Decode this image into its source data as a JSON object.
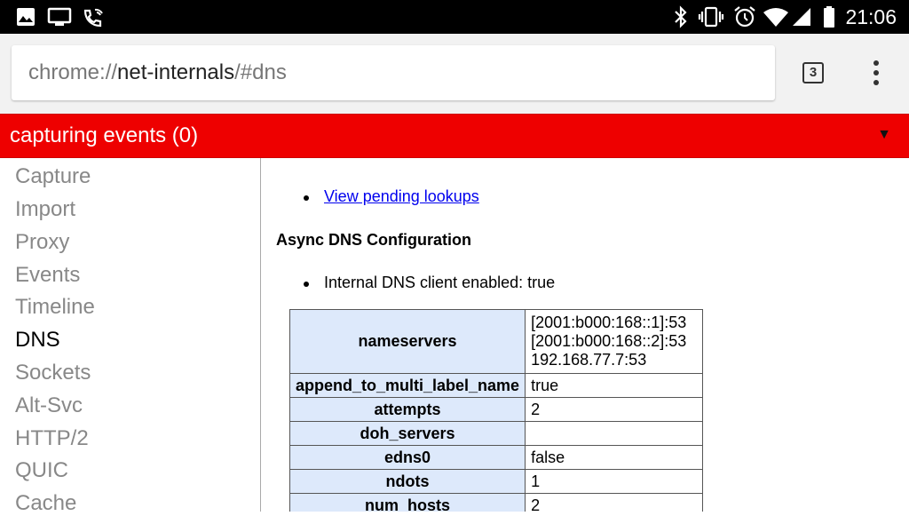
{
  "status_bar": {
    "left_icons": [
      "image-icon",
      "cast-icon",
      "wifi-call-icon"
    ],
    "right_icons": [
      "bluetooth-icon",
      "vibrate-icon",
      "alarm-icon",
      "wifi-icon",
      "signal-icon",
      "battery-icon"
    ],
    "time": "21:06"
  },
  "toolbar": {
    "url_scheme": "chrome://",
    "url_host": "net-internals",
    "url_path": "/#dns",
    "tab_count": "3"
  },
  "banner": {
    "text": "capturing events (0)",
    "arrow": "▼",
    "color": "#ee0000"
  },
  "sidebar": {
    "items": [
      {
        "label": "Capture"
      },
      {
        "label": "Import"
      },
      {
        "label": "Proxy"
      },
      {
        "label": "Events"
      },
      {
        "label": "Timeline"
      },
      {
        "label": "DNS"
      },
      {
        "label": "Sockets"
      },
      {
        "label": "Alt-Svc"
      },
      {
        "label": "HTTP/2"
      },
      {
        "label": "QUIC"
      },
      {
        "label": "Cache"
      }
    ],
    "active": "DNS"
  },
  "main": {
    "pending_link": "View pending lookups",
    "section_title": "Async DNS Configuration",
    "internal_client": "Internal DNS client enabled: true",
    "config": [
      {
        "key": "nameservers",
        "value": [
          "[2001:b000:168::1]:53",
          "[2001:b000:168::2]:53",
          "192.168.77.7:53"
        ]
      },
      {
        "key": "append_to_multi_label_name",
        "value": "true"
      },
      {
        "key": "attempts",
        "value": "2"
      },
      {
        "key": "doh_servers",
        "value": ""
      },
      {
        "key": "edns0",
        "value": "false"
      },
      {
        "key": "ndots",
        "value": "1"
      },
      {
        "key": "num_hosts",
        "value": "2"
      }
    ]
  }
}
